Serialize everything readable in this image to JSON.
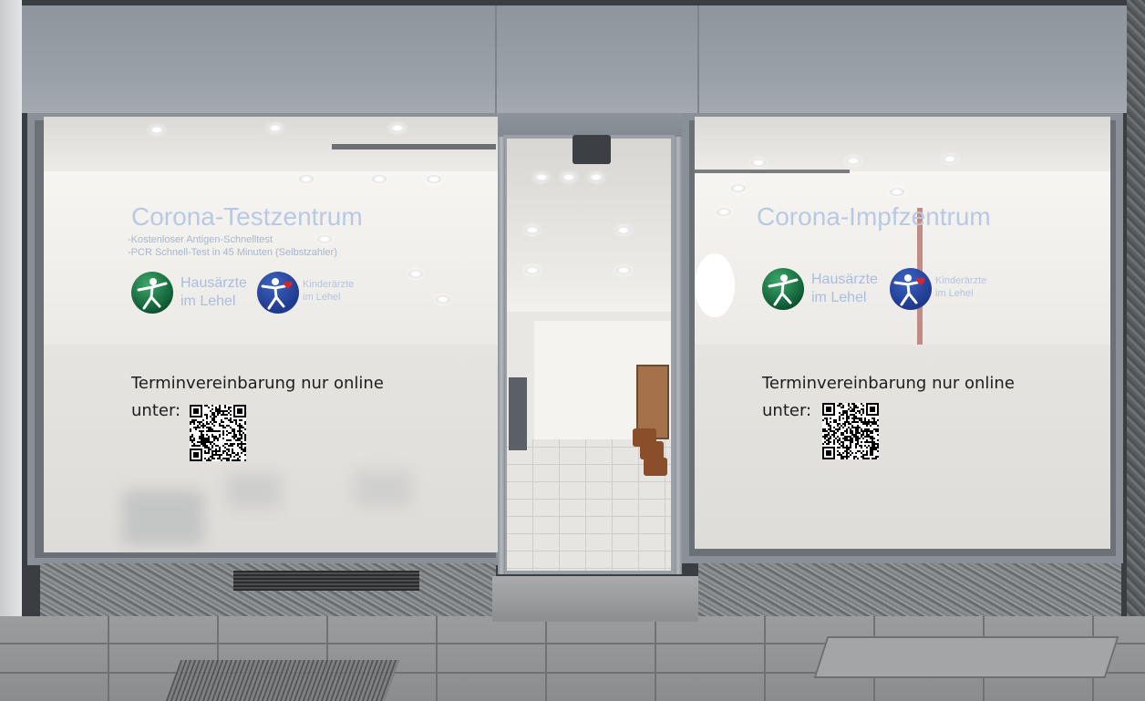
{
  "scene": {
    "left_window": {
      "title": "Corona-Testzentrum",
      "subtitle_lines": [
        "-Kostenloser Antigen-Schnelltest",
        "-PCR Schnell-Test in 45 Minuten (Selbstzahler)"
      ],
      "logo1_text_lines": [
        "Hausärzte",
        "im Lehel"
      ],
      "logo2_text_lines": [
        "Kinderärzte",
        "im Lehel"
      ],
      "appointment_lines": [
        "Terminvereinbarung nur online",
        "unter:"
      ]
    },
    "right_window": {
      "title": "Corona-Impfzentrum",
      "logo1_text_lines": [
        "Hausärzte",
        "im Lehel"
      ],
      "logo2_text_lines": [
        "Kinderärzte",
        "im Lehel"
      ],
      "appointment_lines": [
        "Terminvereinbarung nur online",
        "unter:"
      ]
    },
    "colors": {
      "frame": "#8a9097",
      "title_text": "#b9c9e3",
      "appointment_text": "#1d1d1d",
      "logo_green": "#1f7a47",
      "logo_blue": "#2a4fb0",
      "heart_red": "#d8262c"
    },
    "icons": [
      "qr-code-icon",
      "person-figure-icon",
      "heart-icon"
    ]
  }
}
